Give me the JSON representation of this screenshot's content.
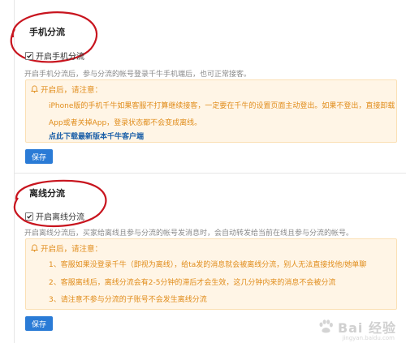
{
  "split_section": {
    "title": "手机分流",
    "checkbox_label": "开启手机分流",
    "description": "开启手机分流后，参与分流的帐号登录千牛手机端后，也可正常接客。",
    "notice_title": "开启后，请注意：",
    "notice_line1": "iPhone版的手机千牛如果客服不打算继续接客，一定要在千牛的设置页面主动登出。如果不登出，直接卸载",
    "notice_line2": "App或者关掉App，登录状态都不会变成离线。",
    "notice_link": "点此下载最新版本千牛客户端",
    "save_label": "保存"
  },
  "offline_section": {
    "title": "离线分流",
    "checkbox_label": "开启离线分流",
    "description": "开启离线分流后，买家给离线且参与分流的帐号发消息时，会自动转发给当前在线且参与分流的帐号。",
    "notice_title": "开启后，请注意：",
    "items": [
      "1、客服如果没登录千牛（即视为离线），给ta发的消息就会被离线分流，别人无法直接找他/她单聊",
      "2、客服离线后，离线分流会有2-5分钟的滞后才会生效，这几分钟内来的消息不会被分流",
      "3、请注意不参与分流的子账号不会发生离线分流"
    ],
    "save_label": "保存"
  },
  "watermark": {
    "text": "Bai 经验",
    "sub": "jingyan.baidu.com"
  },
  "colors": {
    "accent": "#2a7bd6",
    "notice_bg": "#fff5e6",
    "notice_text": "#e08c1a",
    "link": "#1a5fa8",
    "annotation": "#c8141e"
  }
}
